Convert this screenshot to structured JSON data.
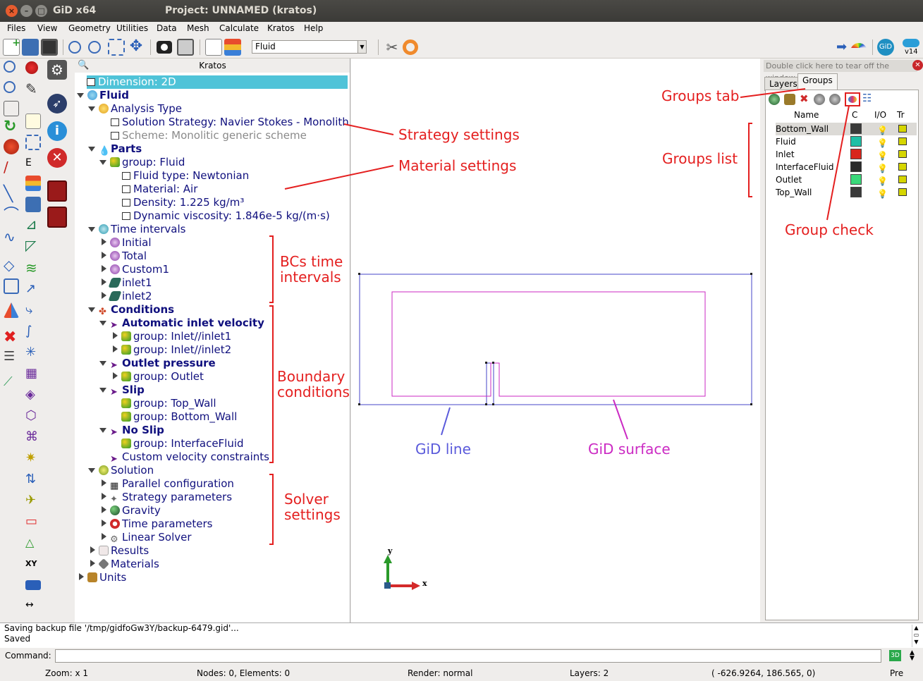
{
  "window": {
    "app_title": "GiD x64",
    "title": "Project: UNNAMED (kratos)"
  },
  "menu": [
    "Files",
    "View",
    "Geometry",
    "Utilities",
    "Data",
    "Mesh",
    "Calculate",
    "Kratos",
    "Help"
  ],
  "toolbar": {
    "layer_value": "Fluid",
    "version_label": "v14"
  },
  "tree": {
    "header": "Kratos",
    "rows": [
      {
        "text": "Dimension: 2D"
      },
      {
        "text": "Fluid"
      },
      {
        "text": "Analysis Type"
      },
      {
        "text": "Solution Strategy: Navier Stokes - Monolithic"
      },
      {
        "text": "Scheme: Monolitic generic scheme"
      },
      {
        "text": "Parts"
      },
      {
        "text": "group: Fluid"
      },
      {
        "text": "Fluid type: Newtonian"
      },
      {
        "text": "Material: Air"
      },
      {
        "text": "Density: 1.225 kg/m³"
      },
      {
        "text": "Dynamic viscosity: 1.846e-5 kg/(m·s)"
      },
      {
        "text": "Time intervals"
      },
      {
        "text": "Initial"
      },
      {
        "text": "Total"
      },
      {
        "text": "Custom1"
      },
      {
        "text": "inlet1"
      },
      {
        "text": "inlet2"
      },
      {
        "text": "Conditions"
      },
      {
        "text": "Automatic inlet velocity"
      },
      {
        "text": "group: Inlet//inlet1"
      },
      {
        "text": "group: Inlet//inlet2"
      },
      {
        "text": "Outlet pressure"
      },
      {
        "text": "group: Outlet"
      },
      {
        "text": "Slip"
      },
      {
        "text": "group: Top_Wall"
      },
      {
        "text": "group: Bottom_Wall"
      },
      {
        "text": "No Slip"
      },
      {
        "text": "group: InterfaceFluid"
      },
      {
        "text": "Custom velocity constraints"
      },
      {
        "text": "Solution"
      },
      {
        "text": "Parallel configuration"
      },
      {
        "text": "Strategy parameters"
      },
      {
        "text": "Gravity"
      },
      {
        "text": "Time parameters"
      },
      {
        "text": "Linear Solver"
      },
      {
        "text": "Results"
      },
      {
        "text": "Materials"
      },
      {
        "text": "Units"
      }
    ]
  },
  "groups_panel": {
    "tearoff": "Double click here to tear off the window",
    "tabs": [
      "Layers",
      "Groups"
    ],
    "columns": [
      "Name",
      "C",
      "I/O",
      "Tr"
    ],
    "groups": [
      {
        "name": "Bottom_Wall",
        "color": "#3a3a3a"
      },
      {
        "name": "Fluid",
        "color": "#1fbfa6"
      },
      {
        "name": "Inlet",
        "color": "#d8261c"
      },
      {
        "name": "InterfaceFluid",
        "color": "#2a2a2a"
      },
      {
        "name": "Outlet",
        "color": "#3ad87a"
      },
      {
        "name": "Top_Wall",
        "color": "#3a3a3a"
      }
    ]
  },
  "annotations": {
    "strategy": "Strategy settings",
    "material": "Material settings",
    "bcs_time_1": "BCs time",
    "bcs_time_2": "intervals",
    "boundary_1": "Boundary",
    "boundary_2": "conditions",
    "solver_1": "Solver",
    "solver_2": "settings",
    "groups_tab": "Groups tab",
    "groups_list": "Groups list",
    "group_check": "Group check",
    "gid_line": "GiD line",
    "gid_surface": "GiD surface"
  },
  "axes": {
    "x": "x",
    "y": "y"
  },
  "log": [
    "Saving backup file '/tmp/gidfoGw3Y/backup-6479.gid'...",
    "Saved"
  ],
  "command_label": "Command:",
  "status": {
    "zoom": "Zoom: x 1",
    "nodes": "Nodes: 0, Elements: 0",
    "render": "Render: normal",
    "layers": "Layers: 2",
    "coords": "( -626.9264,  186.565,  0)",
    "mode": "Pre"
  }
}
